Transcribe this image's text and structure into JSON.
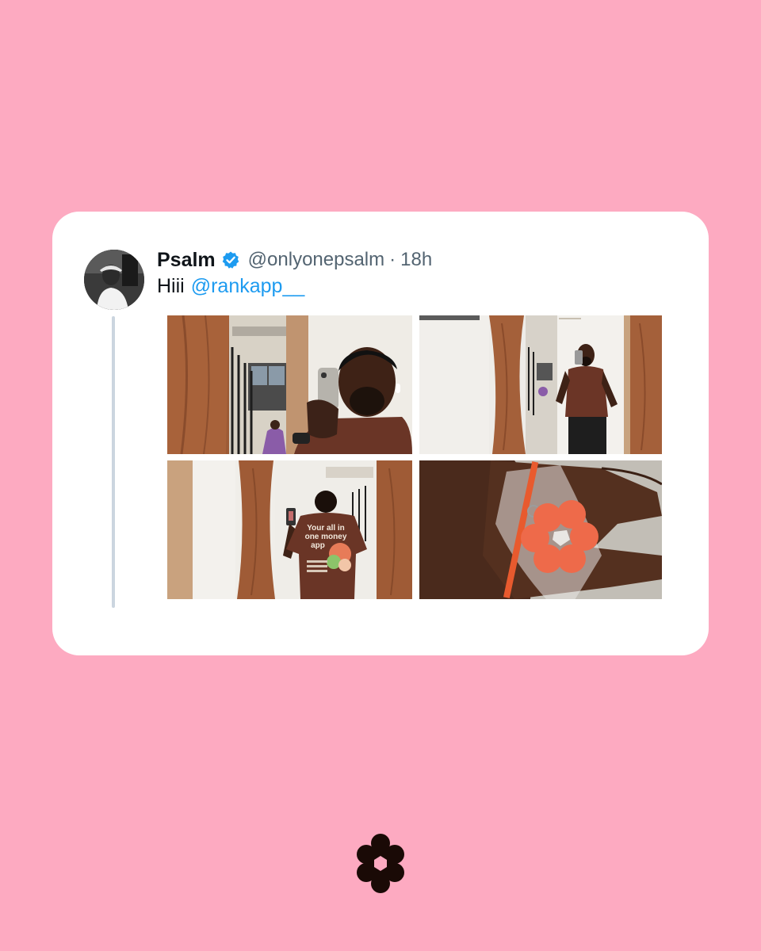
{
  "tweet": {
    "name": "Psalm",
    "handle": "@onlyonepsalm",
    "separator": "·",
    "time": "18h",
    "text": "Hiii",
    "mention": "@rankapp__",
    "verified_color": "#1d9bf0",
    "mention_color": "#1d9bf0"
  },
  "media": [
    {
      "description": "mirror selfie close-up holding phone"
    },
    {
      "description": "mirror selfie full body in brown t-shirt"
    },
    {
      "description": "back view of t-shirt print"
    },
    {
      "description": "hand holding flower-shaped keychain in plastic bag"
    }
  ],
  "shirt_print": {
    "line1": "Your all in",
    "line2": "one money",
    "line3": "app"
  },
  "colors": {
    "background": "#fdaac1",
    "card": "#ffffff",
    "logo": "#1a0a06"
  },
  "icons": {
    "verified": "verified-badge-icon",
    "brand_logo": "flower-logo-icon"
  }
}
